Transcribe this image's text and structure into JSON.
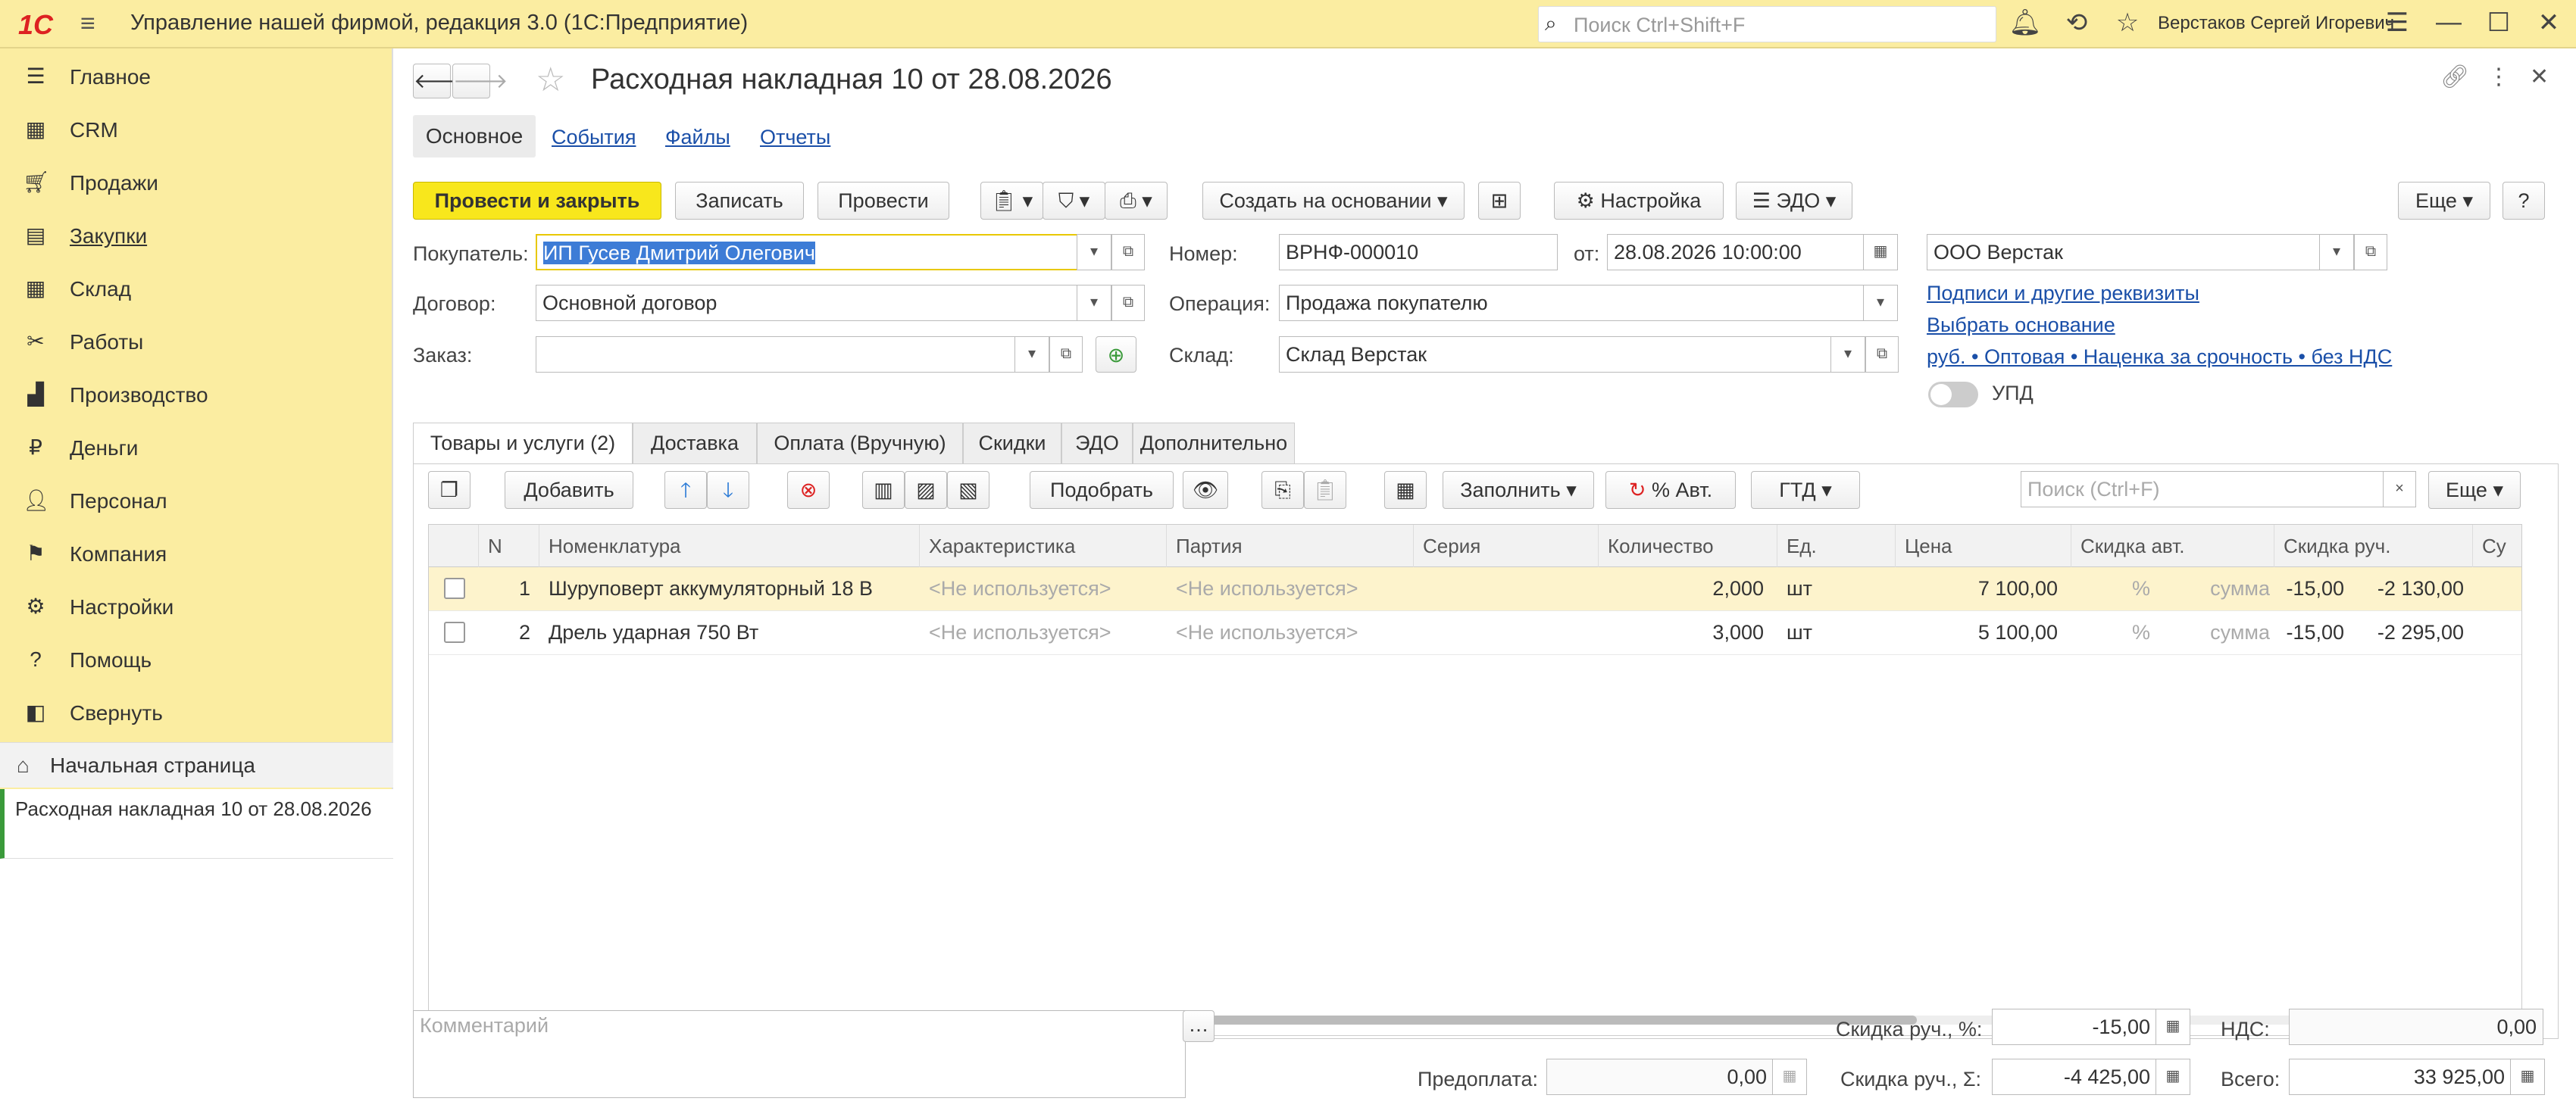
{
  "app": {
    "title": "Управление нашей фирмой, редакция 3.0  (1С:Предприятие)",
    "logo": "1С",
    "user": "Верстаков Сергей Игоревич",
    "search_placeholder": "Поиск Ctrl+Shift+F"
  },
  "sidebar": {
    "items": [
      {
        "label": "Главное",
        "icon": "list-icon"
      },
      {
        "label": "CRM",
        "icon": "crm-icon"
      },
      {
        "label": "Продажи",
        "icon": "cart-icon"
      },
      {
        "label": "Закупки",
        "icon": "purchase-icon"
      },
      {
        "label": "Склад",
        "icon": "warehouse-icon"
      },
      {
        "label": "Работы",
        "icon": "tools-icon"
      },
      {
        "label": "Производство",
        "icon": "factory-icon"
      },
      {
        "label": "Деньги",
        "icon": "money-icon"
      },
      {
        "label": "Персонал",
        "icon": "staff-icon"
      },
      {
        "label": "Компания",
        "icon": "flag-icon"
      },
      {
        "label": "Настройки",
        "icon": "gear-icon"
      },
      {
        "label": "Помощь",
        "icon": "help-icon"
      },
      {
        "label": "Свернуть",
        "icon": "collapse-icon"
      }
    ],
    "home": "Начальная страница",
    "open_doc": "Расходная накладная 10 от 28.08.2026"
  },
  "doc": {
    "title": "Расходная накладная 10 от 28.08.2026",
    "tabs": [
      "Основное",
      "События",
      "Файлы",
      "Отчеты"
    ],
    "toolbar": {
      "post_close": "Провести и закрыть",
      "save": "Записать",
      "post": "Провести",
      "create_based": "Создать на основании",
      "settings": "Настройка",
      "edo": "ЭДО",
      "more": "Еще",
      "help": "?"
    },
    "fields": {
      "buyer_label": "Покупатель:",
      "buyer": "ИП Гусев Дмитрий Олегович",
      "contract_label": "Договор:",
      "contract": "Основной договор",
      "order_label": "Заказ:",
      "order": "",
      "number_label": "Номер:",
      "number": "ВРНФ-000010",
      "date_label": "от:",
      "date": "28.08.2026 10:00:00",
      "operation_label": "Операция:",
      "operation": "Продажа покупателю",
      "warehouse_label": "Склад:",
      "warehouse": "Склад Верстак",
      "company": "ООО Верстак",
      "link_signatures": "Подписи и другие реквизиты",
      "link_choose_basis": "Выбрать основание",
      "link_prices": "руб. • Оптовая • Наценка за срочность • без НДС",
      "upd": "УПД"
    },
    "lower_tabs": [
      "Товары и услуги (2)",
      "Доставка",
      "Оплата (Вручную)",
      "Скидки",
      "ЭДО",
      "Дополнительно"
    ],
    "table_toolbar": {
      "add": "Добавить",
      "pick": "Подобрать",
      "fill": "Заполнить",
      "auto_pct": "% Авт.",
      "gtd": "ГТД",
      "search_placeholder": "Поиск (Ctrl+F)",
      "more": "Еще"
    },
    "table": {
      "headers": [
        "N",
        "Номенклатура",
        "Характеристика",
        "Партия",
        "Серия",
        "Количество",
        "Ед.",
        "Цена",
        "Скидка авт.",
        "Скидка руч.",
        "Су"
      ],
      "rows": [
        {
          "n": "1",
          "item": "Шуруповерт аккумуляторный 18 В",
          "char": "<Не используется>",
          "batch": "<Не используется>",
          "series": "",
          "qty": "2,000",
          "unit": "шт",
          "price": "7 100,00",
          "auto_pct": "%",
          "auto_sum": "сумма",
          "man_pct": "-15,00",
          "man_sum": "-2 130,00"
        },
        {
          "n": "2",
          "item": "Дрель ударная 750 Вт",
          "char": "<Не используется>",
          "batch": "<Не используется>",
          "series": "",
          "qty": "3,000",
          "unit": "шт",
          "price": "5 100,00",
          "auto_pct": "%",
          "auto_sum": "сумма",
          "man_pct": "-15,00",
          "man_sum": "-2 295,00"
        }
      ]
    },
    "footer": {
      "comment_placeholder": "Комментарий",
      "prepay_label": "Предоплата:",
      "prepay": "0,00",
      "disc_pct_label": "Скидка руч., %:",
      "disc_pct": "-15,00",
      "disc_sum_label": "Скидка руч., Σ:",
      "disc_sum": "-4 425,00",
      "vat_label": "НДС:",
      "vat": "0,00",
      "total_label": "Всего:",
      "total": "33 925,00"
    }
  }
}
